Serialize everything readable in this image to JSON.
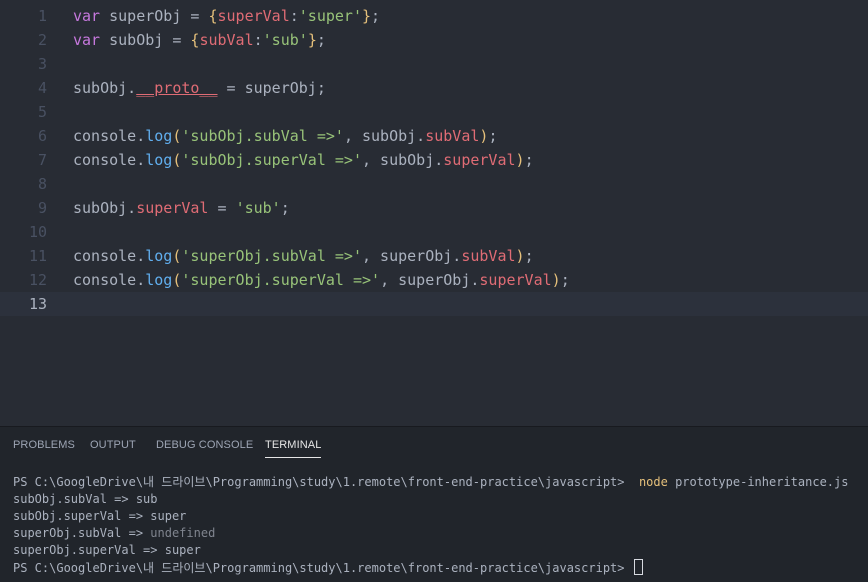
{
  "editor": {
    "line_numbers": [
      "1",
      "2",
      "3",
      "4",
      "5",
      "6",
      "7",
      "8",
      "9",
      "10",
      "11",
      "12",
      "13"
    ],
    "lines": [
      [
        {
          "t": "var",
          "c": "kw"
        },
        {
          "t": " superObj = ",
          "c": "plain"
        },
        {
          "t": "{",
          "c": "br1"
        },
        {
          "t": "superVal",
          "c": "prop"
        },
        {
          "t": ":",
          "c": "plain"
        },
        {
          "t": "'super'",
          "c": "str"
        },
        {
          "t": "}",
          "c": "br1"
        },
        {
          "t": ";",
          "c": "plain"
        }
      ],
      [
        {
          "t": "var",
          "c": "kw"
        },
        {
          "t": " subObj = ",
          "c": "plain"
        },
        {
          "t": "{",
          "c": "br1"
        },
        {
          "t": "subVal",
          "c": "prop"
        },
        {
          "t": ":",
          "c": "plain"
        },
        {
          "t": "'sub'",
          "c": "str"
        },
        {
          "t": "}",
          "c": "br1"
        },
        {
          "t": ";",
          "c": "plain"
        }
      ],
      [],
      [
        {
          "t": "subObj.",
          "c": "plain"
        },
        {
          "t": "__proto__",
          "c": "proto"
        },
        {
          "t": " = superObj;",
          "c": "plain"
        }
      ],
      [],
      [
        {
          "t": "console.",
          "c": "plain"
        },
        {
          "t": "log",
          "c": "fn"
        },
        {
          "t": "(",
          "c": "br1"
        },
        {
          "t": "'subObj.subVal =>'",
          "c": "str"
        },
        {
          "t": ", subObj.",
          "c": "plain"
        },
        {
          "t": "subVal",
          "c": "prop"
        },
        {
          "t": ")",
          "c": "br1"
        },
        {
          "t": ";",
          "c": "plain"
        }
      ],
      [
        {
          "t": "console.",
          "c": "plain"
        },
        {
          "t": "log",
          "c": "fn"
        },
        {
          "t": "(",
          "c": "br1"
        },
        {
          "t": "'subObj.superVal =>'",
          "c": "str"
        },
        {
          "t": ", subObj.",
          "c": "plain"
        },
        {
          "t": "superVal",
          "c": "prop"
        },
        {
          "t": ")",
          "c": "br1"
        },
        {
          "t": ";",
          "c": "plain"
        }
      ],
      [],
      [
        {
          "t": "subObj.",
          "c": "plain"
        },
        {
          "t": "superVal",
          "c": "prop"
        },
        {
          "t": " = ",
          "c": "plain"
        },
        {
          "t": "'sub'",
          "c": "str"
        },
        {
          "t": ";",
          "c": "plain"
        }
      ],
      [],
      [
        {
          "t": "console.",
          "c": "plain"
        },
        {
          "t": "log",
          "c": "fn"
        },
        {
          "t": "(",
          "c": "br1"
        },
        {
          "t": "'superObj.subVal =>'",
          "c": "str"
        },
        {
          "t": ", superObj.",
          "c": "plain"
        },
        {
          "t": "subVal",
          "c": "prop"
        },
        {
          "t": ")",
          "c": "br1"
        },
        {
          "t": ";",
          "c": "plain"
        }
      ],
      [
        {
          "t": "console.",
          "c": "plain"
        },
        {
          "t": "log",
          "c": "fn"
        },
        {
          "t": "(",
          "c": "br1"
        },
        {
          "t": "'superObj.superVal =>'",
          "c": "str"
        },
        {
          "t": ", superObj.",
          "c": "plain"
        },
        {
          "t": "superVal",
          "c": "prop"
        },
        {
          "t": ")",
          "c": "br1"
        },
        {
          "t": ";",
          "c": "plain"
        }
      ],
      []
    ],
    "active_line": 13
  },
  "panel": {
    "tabs": [
      {
        "label": "PROBLEMS",
        "active": false
      },
      {
        "label": "OUTPUT",
        "active": false
      },
      {
        "label": "DEBUG CONSOLE",
        "active": false
      },
      {
        "label": "TERMINAL",
        "active": true
      }
    ]
  },
  "terminal": {
    "lines": [
      [
        {
          "t": "PS C:\\GoogleDrive\\내 드라이브\\Programming\\study\\1.remote\\front-end-practice\\javascript>  ",
          "c": "plain"
        },
        {
          "t": "node",
          "c": "cmd"
        },
        {
          "t": " prototype-inheritance.js",
          "c": "plain"
        }
      ],
      [
        {
          "t": "subObj.subVal => sub",
          "c": "plain"
        }
      ],
      [
        {
          "t": "subObj.superVal => super",
          "c": "plain"
        }
      ],
      [
        {
          "t": "superObj.subVal => ",
          "c": "plain"
        },
        {
          "t": "undefined",
          "c": "dim"
        }
      ],
      [
        {
          "t": "superObj.superVal => super",
          "c": "plain"
        }
      ],
      [
        {
          "t": "PS C:\\GoogleDrive\\내 드라이브\\Programming\\study\\1.remote\\front-end-practice\\javascript> ",
          "c": "plain"
        },
        {
          "t": "",
          "c": "cursor"
        }
      ]
    ]
  },
  "colors": {
    "editor_bg": "#282c34",
    "panel_bg": "#21252b",
    "keyword": "#c678dd",
    "property": "#e06c75",
    "string": "#98c379",
    "function": "#61afef",
    "bracket": "#e5c07b"
  }
}
